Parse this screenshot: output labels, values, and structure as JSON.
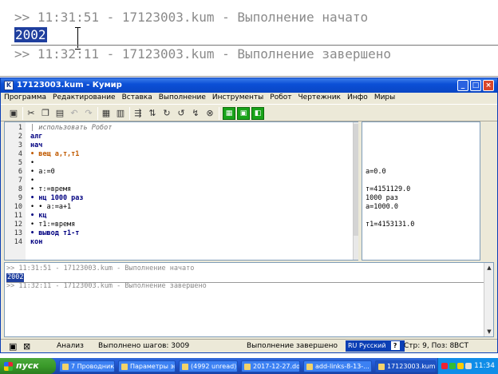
{
  "zoom": {
    "line1": ">> 11:31:51 - 17123003.kum - Выполнение начато",
    "selected": "2002",
    "line2": ">> 11:32:11 - 17123003.kum - Выполнение завершено"
  },
  "window": {
    "title": "17123003.kum - Кумир",
    "minimize": "_",
    "maximize": "□",
    "close": "×"
  },
  "menu": [
    "Программа",
    "Редактирование",
    "Вставка",
    "Выполнение",
    "Инструменты",
    "Робот",
    "Чертежник",
    "Инфо",
    "Миры"
  ],
  "toolbar_icons": [
    "save-icon",
    "cut-icon",
    "copy-icon",
    "paste-icon",
    "undo-icon",
    "redo-icon",
    "insert-doc-icon",
    "format-doc-icon",
    "run-icon",
    "step-icon",
    "step-into-icon",
    "step-out-icon",
    "restart-icon",
    "stop-icon",
    "grid-icon",
    "robot-window-icon",
    "drawer-window-icon"
  ],
  "code": [
    {
      "n": "1",
      "t": "| использовать Робот"
    },
    {
      "n": "2",
      "t": "алг"
    },
    {
      "n": "3",
      "t": "нач"
    },
    {
      "n": "4",
      "t": "• вещ а,т,т1"
    },
    {
      "n": "5",
      "t": "•"
    },
    {
      "n": "6",
      "t": "• а:=0"
    },
    {
      "n": "7",
      "t": "•"
    },
    {
      "n": "8",
      "t": "• т:=время"
    },
    {
      "n": "9",
      "t": "• нц 1000 раз"
    },
    {
      "n": "10",
      "t": "• • а:=а+1"
    },
    {
      "n": "11",
      "t": "• кц"
    },
    {
      "n": "12",
      "t": "• т1:=время"
    },
    {
      "n": "13",
      "t": "• вывод т1-т"
    },
    {
      "n": "14",
      "t": "кон"
    }
  ],
  "margin": {
    "line6": "а=0.0",
    "line8": "т=4151129.0",
    "line9": "1000 раз",
    "line10": "а=1000.0",
    "line12": "т1=4153131.0"
  },
  "console": {
    "line1": ">> 11:31:51 - 17123003.kum - Выполнение начато",
    "selected": "2002",
    "line2": ">> 11:32:11 - 17123003.kum - Выполнение завершено"
  },
  "status": {
    "mode": "Анализ",
    "steps": "Выполнено шагов: 3009",
    "state": "Выполнение завершено",
    "lang": "RU Русский",
    "lang_help": "?",
    "position": "Стр: 9, Поз: 8",
    "insert": "ВСТ"
  },
  "taskbar": {
    "start": "пуск",
    "tasks": [
      "7 Проводник",
      "Параметры эк...",
      "(4992 unread) ...",
      "2017-12-27.do...",
      "add-links-8-13-...",
      "17123003.kum ..."
    ],
    "clock": "11:34"
  }
}
